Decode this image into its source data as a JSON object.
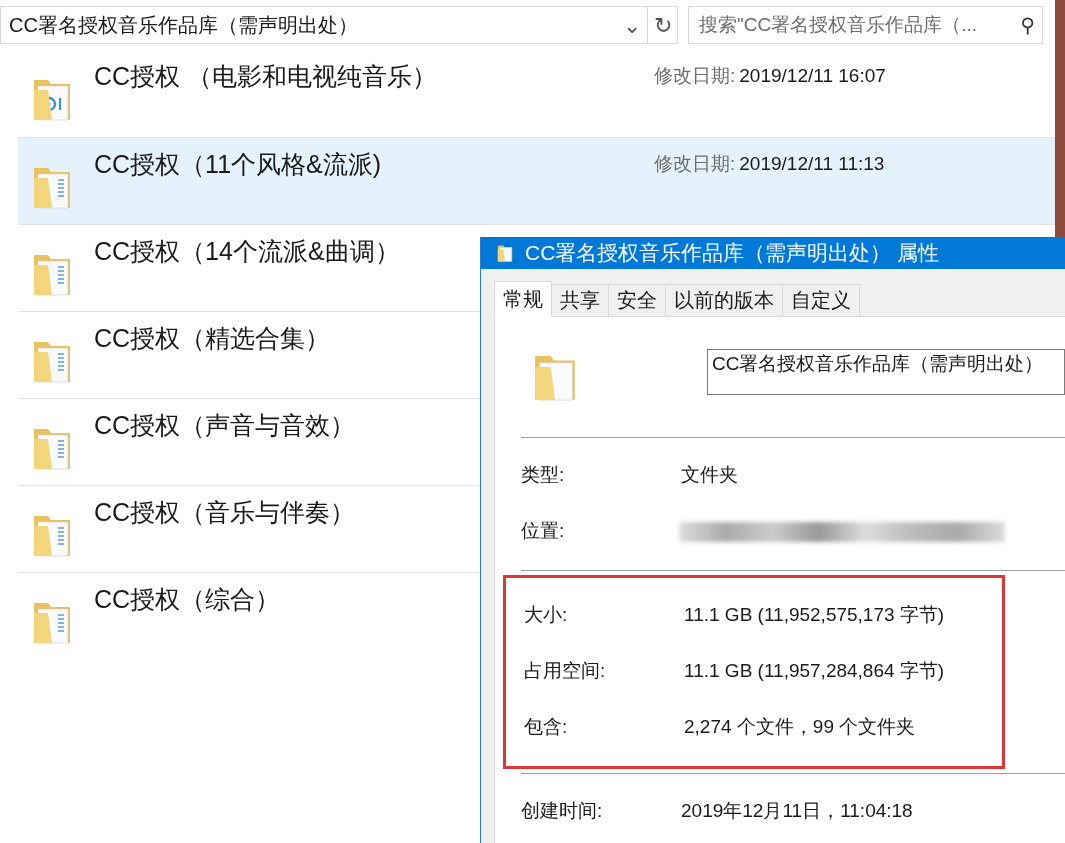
{
  "address_bar": {
    "path": "CC署名授权音乐作品库（需声明出处）",
    "dropdown_glyph": "⌄",
    "refresh_glyph": "↻"
  },
  "search": {
    "placeholder": "搜索\"CC署名授权音乐作品库（...",
    "icon_glyph": "⚲"
  },
  "items": [
    {
      "name": "CC授权 （电影和电视纯音乐）",
      "kind": "media",
      "date_label": "修改日期:",
      "date": "2019/12/11 16:07",
      "selected": false
    },
    {
      "name": "CC授权（11个风格&流派)",
      "kind": "document",
      "date_label": "修改日期:",
      "date": "2019/12/11 11:13",
      "selected": true
    },
    {
      "name": "CC授权（14个流派&曲调）",
      "kind": "document",
      "selected": false
    },
    {
      "name": "CC授权（精选合集）",
      "kind": "document",
      "selected": false
    },
    {
      "name": "CC授权（声音与音效）",
      "kind": "document",
      "selected": false
    },
    {
      "name": "CC授权（音乐与伴奏）",
      "kind": "document",
      "selected": false
    },
    {
      "name": "CC授权（综合）",
      "kind": "document",
      "selected": false
    }
  ],
  "properties_dialog": {
    "title": "CC署名授权音乐作品库（需声明出处） 属性",
    "tabs": [
      {
        "label": "常规",
        "selected": true
      },
      {
        "label": "共享",
        "selected": false
      },
      {
        "label": "安全",
        "selected": false
      },
      {
        "label": "以前的版本",
        "selected": false
      },
      {
        "label": "自定义",
        "selected": false
      }
    ],
    "name_field": {
      "value": "CC署名授权音乐作品库（需声明出处）"
    },
    "sections": [
      {
        "highlighted": false,
        "rows": [
          {
            "kind": "text",
            "label": "类型:",
            "value": "文件夹"
          },
          {
            "kind": "redacted",
            "label": "位置:"
          }
        ]
      },
      {
        "highlighted": true,
        "rows": [
          {
            "kind": "text",
            "label": "大小:",
            "value": "11.1 GB (11,952,575,173 字节)"
          },
          {
            "kind": "text",
            "label": "占用空间:",
            "value": "11.1 GB (11,957,284,864 字节)"
          },
          {
            "kind": "text",
            "label": "包含:",
            "value": "2,274 个文件，99 个文件夹"
          }
        ]
      },
      {
        "highlighted": false,
        "rows": [
          {
            "kind": "text",
            "label": "创建时间:",
            "value": "2019年12月11日，11:04:18"
          }
        ]
      }
    ]
  }
}
